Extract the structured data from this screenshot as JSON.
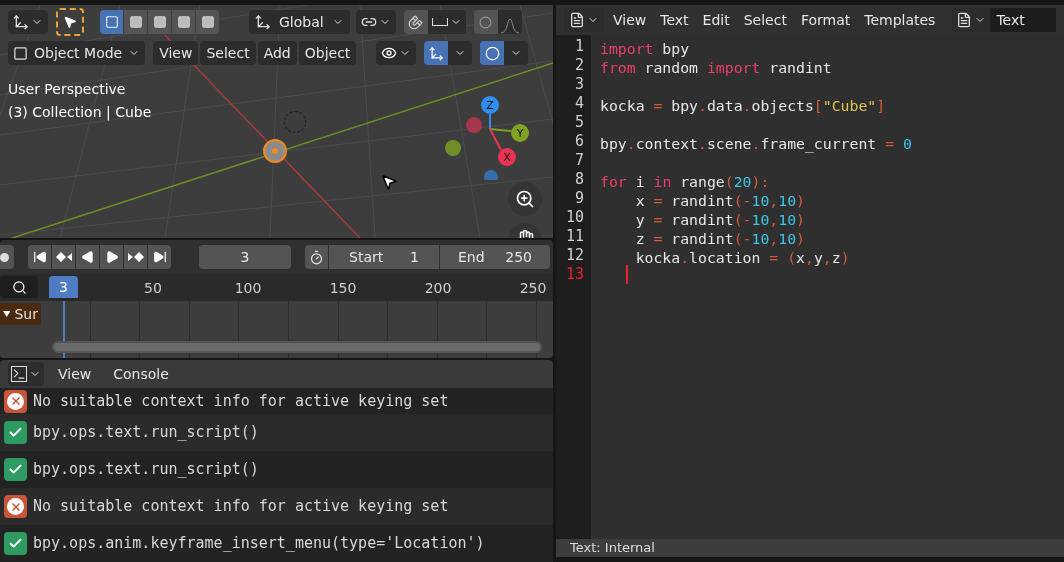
{
  "viewport": {
    "select_modes": [
      {
        "selected": true
      },
      {
        "selected": false
      },
      {
        "selected": false
      },
      {
        "selected": false
      },
      {
        "selected": false
      }
    ],
    "orientation": "Global",
    "toggles": [
      {
        "kind": "snap",
        "on": false
      },
      {
        "kind": "proportional",
        "on": false
      },
      {
        "kind": "gizmo",
        "on": true
      },
      {
        "kind": "overlay",
        "on": true
      }
    ],
    "mode": "Object Mode",
    "menus": [
      "View",
      "Select",
      "Add",
      "Object"
    ],
    "overlay_text": [
      "User Perspective",
      "(3) Collection | Cube"
    ],
    "gizmo_axes": [
      {
        "label": "Z",
        "color": "#2f8ff0"
      },
      {
        "label": "Y",
        "color": "#7fa324"
      },
      {
        "label": "X",
        "color": "#ea3352"
      }
    ]
  },
  "timeline": {
    "current_frame": "3",
    "start_label": "Start",
    "start": "1",
    "end_label": "End",
    "end": "250",
    "playhead": "3",
    "ruler": [
      "50",
      "100",
      "150",
      "200",
      "250"
    ],
    "channel": "Sur"
  },
  "console": {
    "menus": [
      "View",
      "Console"
    ],
    "messages": [
      {
        "kind": "error",
        "text": "No suitable context info for active keying set"
      },
      {
        "kind": "info",
        "text": "bpy.ops.text.run_script()"
      },
      {
        "kind": "info",
        "text": "bpy.ops.text.run_script()"
      },
      {
        "kind": "error",
        "text": "No suitable context info for active keying set"
      },
      {
        "kind": "info",
        "text": "bpy.ops.anim.keyframe_insert_menu(type='Location')"
      }
    ]
  },
  "text_editor": {
    "menus": [
      "View",
      "Text",
      "Edit",
      "Select",
      "Format",
      "Templates"
    ],
    "text_name": "Text",
    "lines": [
      {
        "number": "1",
        "current": false,
        "tokens": [
          {
            "text": "import",
            "kind": "keyword"
          },
          {
            "text": " bpy",
            "kind": "name"
          }
        ]
      },
      {
        "number": "2",
        "current": false,
        "tokens": [
          {
            "text": "from",
            "kind": "keyword"
          },
          {
            "text": " random ",
            "kind": "name"
          },
          {
            "text": "import",
            "kind": "keyword"
          },
          {
            "text": " randint",
            "kind": "name"
          }
        ]
      },
      {
        "number": "3",
        "current": false
      },
      {
        "number": "4",
        "current": false,
        "tokens": [
          {
            "text": "kocka ",
            "kind": "name"
          },
          {
            "text": "=",
            "kind": "punct"
          },
          {
            "text": " bpy",
            "kind": "name"
          },
          {
            "text": ".",
            "kind": "punct"
          },
          {
            "text": "data",
            "kind": "name"
          },
          {
            "text": ".",
            "kind": "punct"
          },
          {
            "text": "objects",
            "kind": "name"
          },
          {
            "text": "[",
            "kind": "punct"
          },
          {
            "text": "\"Cube\"",
            "kind": "string"
          },
          {
            "text": "]",
            "kind": "punct"
          }
        ]
      },
      {
        "number": "5",
        "current": false
      },
      {
        "number": "6",
        "current": false,
        "tokens": [
          {
            "text": "bpy",
            "kind": "name"
          },
          {
            "text": ".",
            "kind": "punct"
          },
          {
            "text": "context",
            "kind": "name"
          },
          {
            "text": ".",
            "kind": "punct"
          },
          {
            "text": "scene",
            "kind": "name"
          },
          {
            "text": ".",
            "kind": "punct"
          },
          {
            "text": "frame_current ",
            "kind": "name"
          },
          {
            "text": "=",
            "kind": "punct"
          },
          {
            "text": " 0",
            "kind": "number"
          }
        ]
      },
      {
        "number": "7",
        "current": false
      },
      {
        "number": "8",
        "current": false,
        "tokens": [
          {
            "text": "for",
            "kind": "keyword"
          },
          {
            "text": " i ",
            "kind": "name"
          },
          {
            "text": "in",
            "kind": "keyword"
          },
          {
            "text": " range",
            "kind": "name"
          },
          {
            "text": "(",
            "kind": "punct"
          },
          {
            "text": "20",
            "kind": "number"
          },
          {
            "text": "):",
            "kind": "punct"
          }
        ]
      },
      {
        "number": "9",
        "current": false,
        "tokens": [
          {
            "text": "    x ",
            "kind": "name"
          },
          {
            "text": "=",
            "kind": "punct"
          },
          {
            "text": " randint",
            "kind": "name"
          },
          {
            "text": "(-",
            "kind": "punct"
          },
          {
            "text": "10",
            "kind": "number"
          },
          {
            "text": ",",
            "kind": "punct"
          },
          {
            "text": "10",
            "kind": "number"
          },
          {
            "text": ")",
            "kind": "punct"
          }
        ]
      },
      {
        "number": "10",
        "current": false,
        "tokens": [
          {
            "text": "    y ",
            "kind": "name"
          },
          {
            "text": "=",
            "kind": "punct"
          },
          {
            "text": " randint",
            "kind": "name"
          },
          {
            "text": "(-",
            "kind": "punct"
          },
          {
            "text": "10",
            "kind": "number"
          },
          {
            "text": ",",
            "kind": "punct"
          },
          {
            "text": "10",
            "kind": "number"
          },
          {
            "text": ")",
            "kind": "punct"
          }
        ]
      },
      {
        "number": "11",
        "current": false,
        "tokens": [
          {
            "text": "    z ",
            "kind": "name"
          },
          {
            "text": "=",
            "kind": "punct"
          },
          {
            "text": " randint",
            "kind": "name"
          },
          {
            "text": "(-",
            "kind": "punct"
          },
          {
            "text": "10",
            "kind": "number"
          },
          {
            "text": ",",
            "kind": "punct"
          },
          {
            "text": "10",
            "kind": "number"
          },
          {
            "text": ")",
            "kind": "punct"
          }
        ]
      },
      {
        "number": "12",
        "current": false,
        "tokens": [
          {
            "text": "    kocka",
            "kind": "name"
          },
          {
            "text": ".",
            "kind": "punct"
          },
          {
            "text": "location ",
            "kind": "name"
          },
          {
            "text": "=",
            "kind": "punct"
          },
          {
            "text": " (",
            "kind": "punct"
          },
          {
            "text": "x",
            "kind": "name"
          },
          {
            "text": ",",
            "kind": "punct"
          },
          {
            "text": "y",
            "kind": "name"
          },
          {
            "text": ",",
            "kind": "punct"
          },
          {
            "text": "z",
            "kind": "name"
          },
          {
            "text": ")",
            "kind": "punct"
          }
        ]
      },
      {
        "number": "13",
        "current": true
      }
    ]
  },
  "status_bar": "Text: Internal"
}
